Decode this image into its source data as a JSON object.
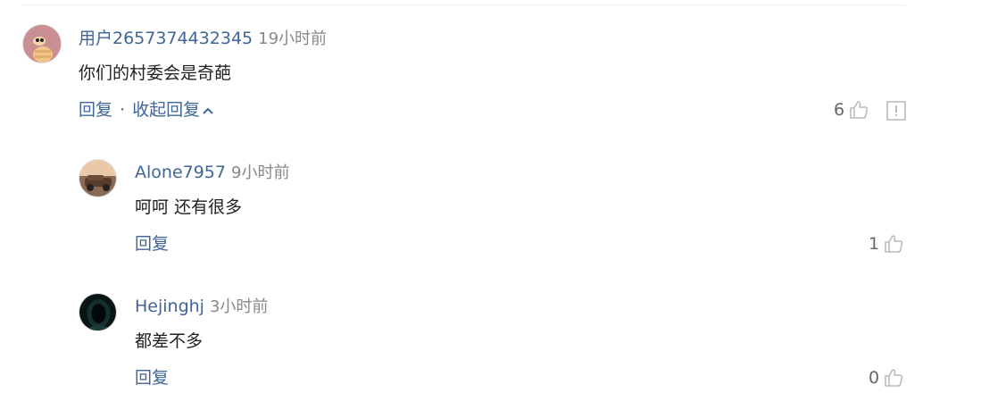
{
  "comments": [
    {
      "username": "用户2657374432345",
      "time": "19小时前",
      "text": "你们的村委会是奇葩",
      "reply_label": "回复",
      "separator": "·",
      "collapse_label": "收起回复",
      "likes": "6",
      "replies": [
        {
          "username": "Alone7957",
          "time": "9小时前",
          "text": "呵呵 还有很多",
          "reply_label": "回复",
          "likes": "1"
        },
        {
          "username": "Hejinghj",
          "time": "3小时前",
          "text": "都差不多",
          "reply_label": "回复",
          "likes": "0"
        }
      ]
    }
  ],
  "colors": {
    "link_blue": "#406599",
    "muted_gray": "#888888",
    "text_dark": "#222222",
    "icon_gray": "#bbbbbb"
  },
  "icons": {
    "like": "thumbs-up-icon",
    "report": "report-icon",
    "collapse": "chevron-up-icon"
  }
}
